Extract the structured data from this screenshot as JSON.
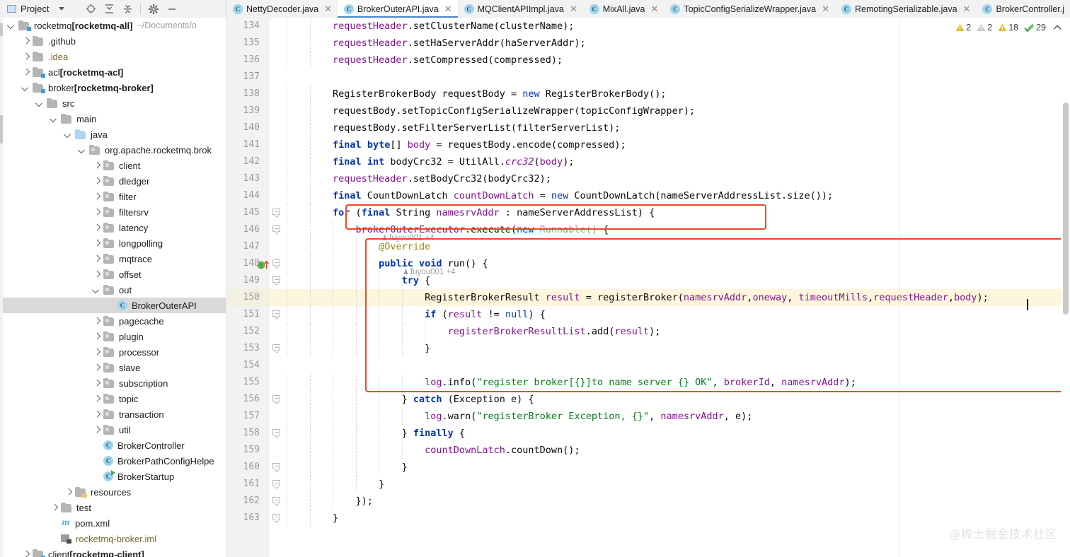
{
  "toolbar": {
    "project_label": "Project",
    "icons": [
      {
        "name": "locate-icon",
        "title": "Select Opened File"
      },
      {
        "name": "expand-all-icon",
        "title": "Expand All"
      },
      {
        "name": "collapse-all-icon",
        "title": "Collapse All"
      },
      {
        "name": "gear-icon",
        "title": "Settings"
      },
      {
        "name": "minimize-icon",
        "title": "Hide"
      }
    ]
  },
  "tabs": [
    {
      "label": "NettyDecoder.java",
      "icon": "java-class-icon",
      "active": false
    },
    {
      "label": "BrokerOuterAPI.java",
      "icon": "java-class-icon",
      "active": true
    },
    {
      "label": "MQClientAPIImpl.java",
      "icon": "java-class-icon",
      "active": false
    },
    {
      "label": "MixAll.java",
      "icon": "java-class-icon",
      "active": false
    },
    {
      "label": "TopicConfigSerializeWrapper.java",
      "icon": "java-class-icon",
      "active": false
    },
    {
      "label": "RemotingSerializable.java",
      "icon": "java-class-icon",
      "active": false
    },
    {
      "label": "BrokerController.j",
      "icon": "java-class-icon",
      "active": false
    }
  ],
  "tab_close_glyph": "✕",
  "tabs_overflow_glyph": "⌄",
  "tree": [
    {
      "depth": 0,
      "arrow": "down",
      "icon": "module-folder",
      "label": "rocketmq ",
      "bold": "[rocketmq-all]",
      "path": "~/Documents/o",
      "selected": false
    },
    {
      "depth": 1,
      "arrow": "right",
      "icon": "folder",
      "label": ".github",
      "bold": "",
      "path": "",
      "selected": false
    },
    {
      "depth": 1,
      "arrow": "right",
      "icon": "folder",
      "label": ".idea",
      "bold": "",
      "path": "",
      "selected": false,
      "muted": true
    },
    {
      "depth": 1,
      "arrow": "right",
      "icon": "module-folder",
      "label": "acl ",
      "bold": "[rocketmq-acl]",
      "path": "",
      "selected": false
    },
    {
      "depth": 1,
      "arrow": "down",
      "icon": "module-folder",
      "label": "broker ",
      "bold": "[rocketmq-broker]",
      "path": "",
      "selected": false
    },
    {
      "depth": 2,
      "arrow": "down",
      "icon": "folder",
      "label": "src",
      "bold": "",
      "path": "",
      "selected": false
    },
    {
      "depth": 3,
      "arrow": "down",
      "icon": "folder",
      "label": "main",
      "bold": "",
      "path": "",
      "selected": false
    },
    {
      "depth": 4,
      "arrow": "down",
      "icon": "source-folder",
      "label": "java",
      "bold": "",
      "path": "",
      "selected": false
    },
    {
      "depth": 5,
      "arrow": "down",
      "icon": "package",
      "label": "org.apache.rocketmq.brok",
      "bold": "",
      "path": "",
      "selected": false
    },
    {
      "depth": 6,
      "arrow": "right",
      "icon": "package",
      "label": "client",
      "bold": "",
      "path": "",
      "selected": false
    },
    {
      "depth": 6,
      "arrow": "right",
      "icon": "package",
      "label": "dledger",
      "bold": "",
      "path": "",
      "selected": false
    },
    {
      "depth": 6,
      "arrow": "right",
      "icon": "package",
      "label": "filter",
      "bold": "",
      "path": "",
      "selected": false
    },
    {
      "depth": 6,
      "arrow": "right",
      "icon": "package",
      "label": "filtersrv",
      "bold": "",
      "path": "",
      "selected": false
    },
    {
      "depth": 6,
      "arrow": "right",
      "icon": "package",
      "label": "latency",
      "bold": "",
      "path": "",
      "selected": false
    },
    {
      "depth": 6,
      "arrow": "right",
      "icon": "package",
      "label": "longpolling",
      "bold": "",
      "path": "",
      "selected": false
    },
    {
      "depth": 6,
      "arrow": "right",
      "icon": "package",
      "label": "mqtrace",
      "bold": "",
      "path": "",
      "selected": false
    },
    {
      "depth": 6,
      "arrow": "right",
      "icon": "package",
      "label": "offset",
      "bold": "",
      "path": "",
      "selected": false
    },
    {
      "depth": 6,
      "arrow": "down",
      "icon": "package",
      "label": "out",
      "bold": "",
      "path": "",
      "selected": false
    },
    {
      "depth": 7,
      "arrow": "none",
      "icon": "java-class",
      "label": "BrokerOuterAPI",
      "bold": "",
      "path": "",
      "selected": true
    },
    {
      "depth": 6,
      "arrow": "right",
      "icon": "package",
      "label": "pagecache",
      "bold": "",
      "path": "",
      "selected": false
    },
    {
      "depth": 6,
      "arrow": "right",
      "icon": "package",
      "label": "plugin",
      "bold": "",
      "path": "",
      "selected": false
    },
    {
      "depth": 6,
      "arrow": "right",
      "icon": "package",
      "label": "processor",
      "bold": "",
      "path": "",
      "selected": false
    },
    {
      "depth": 6,
      "arrow": "right",
      "icon": "package",
      "label": "slave",
      "bold": "",
      "path": "",
      "selected": false
    },
    {
      "depth": 6,
      "arrow": "right",
      "icon": "package",
      "label": "subscription",
      "bold": "",
      "path": "",
      "selected": false
    },
    {
      "depth": 6,
      "arrow": "right",
      "icon": "package",
      "label": "topic",
      "bold": "",
      "path": "",
      "selected": false
    },
    {
      "depth": 6,
      "arrow": "right",
      "icon": "package",
      "label": "transaction",
      "bold": "",
      "path": "",
      "selected": false
    },
    {
      "depth": 6,
      "arrow": "right",
      "icon": "package",
      "label": "util",
      "bold": "",
      "path": "",
      "selected": false
    },
    {
      "depth": 6,
      "arrow": "none",
      "icon": "java-class",
      "label": "BrokerController",
      "bold": "",
      "path": "",
      "selected": false
    },
    {
      "depth": 6,
      "arrow": "none",
      "icon": "java-class",
      "label": "BrokerPathConfigHelpe",
      "bold": "",
      "path": "",
      "selected": false
    },
    {
      "depth": 6,
      "arrow": "none",
      "icon": "java-class-run",
      "label": "BrokerStartup",
      "bold": "",
      "path": "",
      "selected": false
    },
    {
      "depth": 4,
      "arrow": "right",
      "icon": "resource-folder",
      "label": "resources",
      "bold": "",
      "path": "",
      "selected": false
    },
    {
      "depth": 3,
      "arrow": "right",
      "icon": "folder",
      "label": "test",
      "bold": "",
      "path": "",
      "selected": false
    },
    {
      "depth": 3,
      "arrow": "none",
      "icon": "maven",
      "label": "pom.xml",
      "bold": "",
      "path": "",
      "selected": false
    },
    {
      "depth": 3,
      "arrow": "none",
      "icon": "iml",
      "label": "rocketmq-broker.iml",
      "bold": "",
      "path": "",
      "selected": false,
      "iml": true
    },
    {
      "depth": 1,
      "arrow": "right",
      "icon": "module-folder",
      "label": "client ",
      "bold": "[rocketmq-client]",
      "path": "",
      "selected": false
    }
  ],
  "inspection": {
    "items": [
      {
        "name": "error-count",
        "icon": "warning-triangle-yellow",
        "count": "2"
      },
      {
        "name": "weak-warning-count",
        "icon": "warning-triangle-grey",
        "count": "2"
      },
      {
        "name": "warning-count",
        "icon": "warning-triangle-yellow",
        "count": "18"
      },
      {
        "name": "typo-count",
        "icon": "spellcheck-icon",
        "count": "29"
      }
    ],
    "collapse_glyph": "⌃"
  },
  "code": {
    "first_line": 134,
    "highlighted_line": 150,
    "lines": [
      {
        "n": 134,
        "indent": 2,
        "fold": false
      },
      {
        "n": 135,
        "indent": 2,
        "fold": false
      },
      {
        "n": 136,
        "indent": 2,
        "fold": false
      },
      {
        "n": 137,
        "indent": 0,
        "fold": false
      },
      {
        "n": 138,
        "indent": 2,
        "fold": false
      },
      {
        "n": 139,
        "indent": 2,
        "fold": false
      },
      {
        "n": 140,
        "indent": 2,
        "fold": false
      },
      {
        "n": 141,
        "indent": 2,
        "fold": false
      },
      {
        "n": 142,
        "indent": 2,
        "fold": false
      },
      {
        "n": 143,
        "indent": 2,
        "fold": false
      },
      {
        "n": 144,
        "indent": 2,
        "fold": false
      },
      {
        "n": 145,
        "indent": 2,
        "fold": true
      },
      {
        "n": 146,
        "indent": 3,
        "fold": true
      },
      {
        "n": 147,
        "indent": 4,
        "fold": false
      },
      {
        "n": 148,
        "indent": 4,
        "fold": true,
        "gutter": "override-impl"
      },
      {
        "n": 149,
        "indent": 5,
        "fold": true
      },
      {
        "n": 150,
        "indent": 6,
        "fold": false
      },
      {
        "n": 151,
        "indent": 6,
        "fold": true
      },
      {
        "n": 152,
        "indent": 7,
        "fold": false
      },
      {
        "n": 153,
        "indent": 6,
        "fold": true
      },
      {
        "n": 154,
        "indent": 0,
        "fold": false
      },
      {
        "n": 155,
        "indent": 6,
        "fold": false
      },
      {
        "n": 156,
        "indent": 5,
        "fold": true
      },
      {
        "n": 157,
        "indent": 6,
        "fold": false
      },
      {
        "n": 158,
        "indent": 5,
        "fold": true
      },
      {
        "n": 159,
        "indent": 6,
        "fold": false
      },
      {
        "n": 160,
        "indent": 5,
        "fold": true
      },
      {
        "n": 161,
        "indent": 4,
        "fold": true
      },
      {
        "n": 162,
        "indent": 3,
        "fold": true
      },
      {
        "n": 163,
        "indent": 2,
        "fold": true
      }
    ],
    "text": {
      "l134": "requestHeader.setClusterName(clusterName);",
      "l135": "requestHeader.setHaServerAddr(haServerAddr);",
      "l136": "requestHeader.setCompressed(compressed);",
      "l137": "",
      "l138": "RegisterBrokerBody requestBody = new RegisterBrokerBody();",
      "l139": "requestBody.setTopicConfigSerializeWrapper(topicConfigWrapper);",
      "l140": "requestBody.setFilterServerList(filterServerList);",
      "l141": "final byte[] body = requestBody.encode(compressed);",
      "l142": "final int bodyCrc32 = UtilAll.crc32(body);",
      "l143": "requestHeader.setBodyCrc32(bodyCrc32);",
      "l144": "final CountDownLatch countDownLatch = new CountDownLatch(nameServerAddressList.size());",
      "l145": "for (final String namesrvAddr : nameServerAddressList) {",
      "l146": "brokerOuterExecutor.execute(new Runnable() {",
      "l147": "@Override",
      "l148": "public void run() {",
      "l149": "try {",
      "l150": "RegisterBrokerResult result = registerBroker(namesrvAddr,oneway, timeoutMills,requestHeader,body);",
      "l151": "if (result != null) {",
      "l152": "registerBrokerResultList.add(result);",
      "l153": "}",
      "l154": "",
      "l155": "log.info(\"register broker[{}]to name server {} OK\", brokerId, namesrvAddr);",
      "l156": "} catch (Exception e) {",
      "l157": "log.warn(\"registerBroker Exception, {}\", namesrvAddr, e);",
      "l158": "} finally {",
      "l159": "countDownLatch.countDown();",
      "l160": "}",
      "l161": "}",
      "l162": "});",
      "l163": "}"
    },
    "annotations": [
      {
        "name": "vcs-author-annotation-145",
        "text": "fuyou001 +4"
      },
      {
        "name": "vcs-author-annotation-146",
        "text": "fuyou001 +4"
      }
    ]
  },
  "watermark": {
    "text": "@稀土掘金技术社区"
  }
}
